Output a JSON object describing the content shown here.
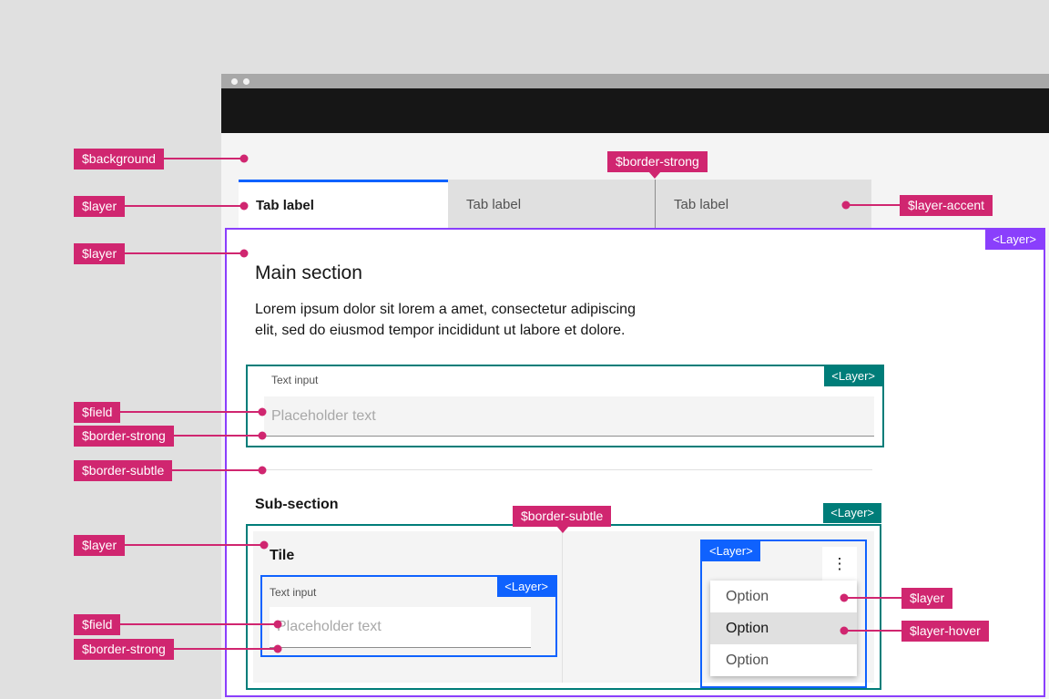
{
  "colors": {
    "annotation_pink": "#d02670",
    "layer_purple": "#8a3ffc",
    "layer_teal": "#007d79",
    "layer_blue": "#0f62fe",
    "background_token": "#f4f4f4",
    "layer_token": "#ffffff",
    "layer_accent_token": "#e0e0e0",
    "border_strong": "#8d8d8d",
    "border_subtle": "#e0e0e0",
    "navbar": "#161616"
  },
  "window": {
    "tabs": [
      {
        "label": "Tab label",
        "state": "selected"
      },
      {
        "label": "Tab label",
        "state": "unselected"
      },
      {
        "label": "Tab label",
        "state": "unselected"
      }
    ]
  },
  "layer_badge_label": "<Layer>",
  "main": {
    "heading": "Main section",
    "body_line1": "Lorem ipsum dolor sit lorem a amet, consectetur adipiscing",
    "body_line2": "elit, sed do eiusmod tempor incididunt ut labore et dolore.",
    "text_input": {
      "label": "Text input",
      "placeholder": "Placeholder text"
    },
    "subsection": {
      "heading": "Sub-section",
      "tile": {
        "heading": "Tile",
        "text_input": {
          "label": "Text input",
          "placeholder": "Placeholder text"
        }
      },
      "dropdown": {
        "overflow_icon": "⋮",
        "options": [
          "Option",
          "Option",
          "Option"
        ],
        "hover_index": 1
      }
    }
  },
  "annotations": {
    "background": "$background",
    "layer_tab": "$layer",
    "layer_main": "$layer",
    "border_strong_tab": "$border-strong",
    "layer_accent": "$layer-accent",
    "field_main": "$field",
    "border_strong_main": "$border-strong",
    "border_subtle_main": "$border-subtle",
    "border_subtle_tile": "$border-subtle",
    "layer_tile": "$layer",
    "field_tile": "$field",
    "border_strong_tile": "$border-strong",
    "layer_menu": "$layer",
    "layer_hover": "$layer-hover"
  }
}
